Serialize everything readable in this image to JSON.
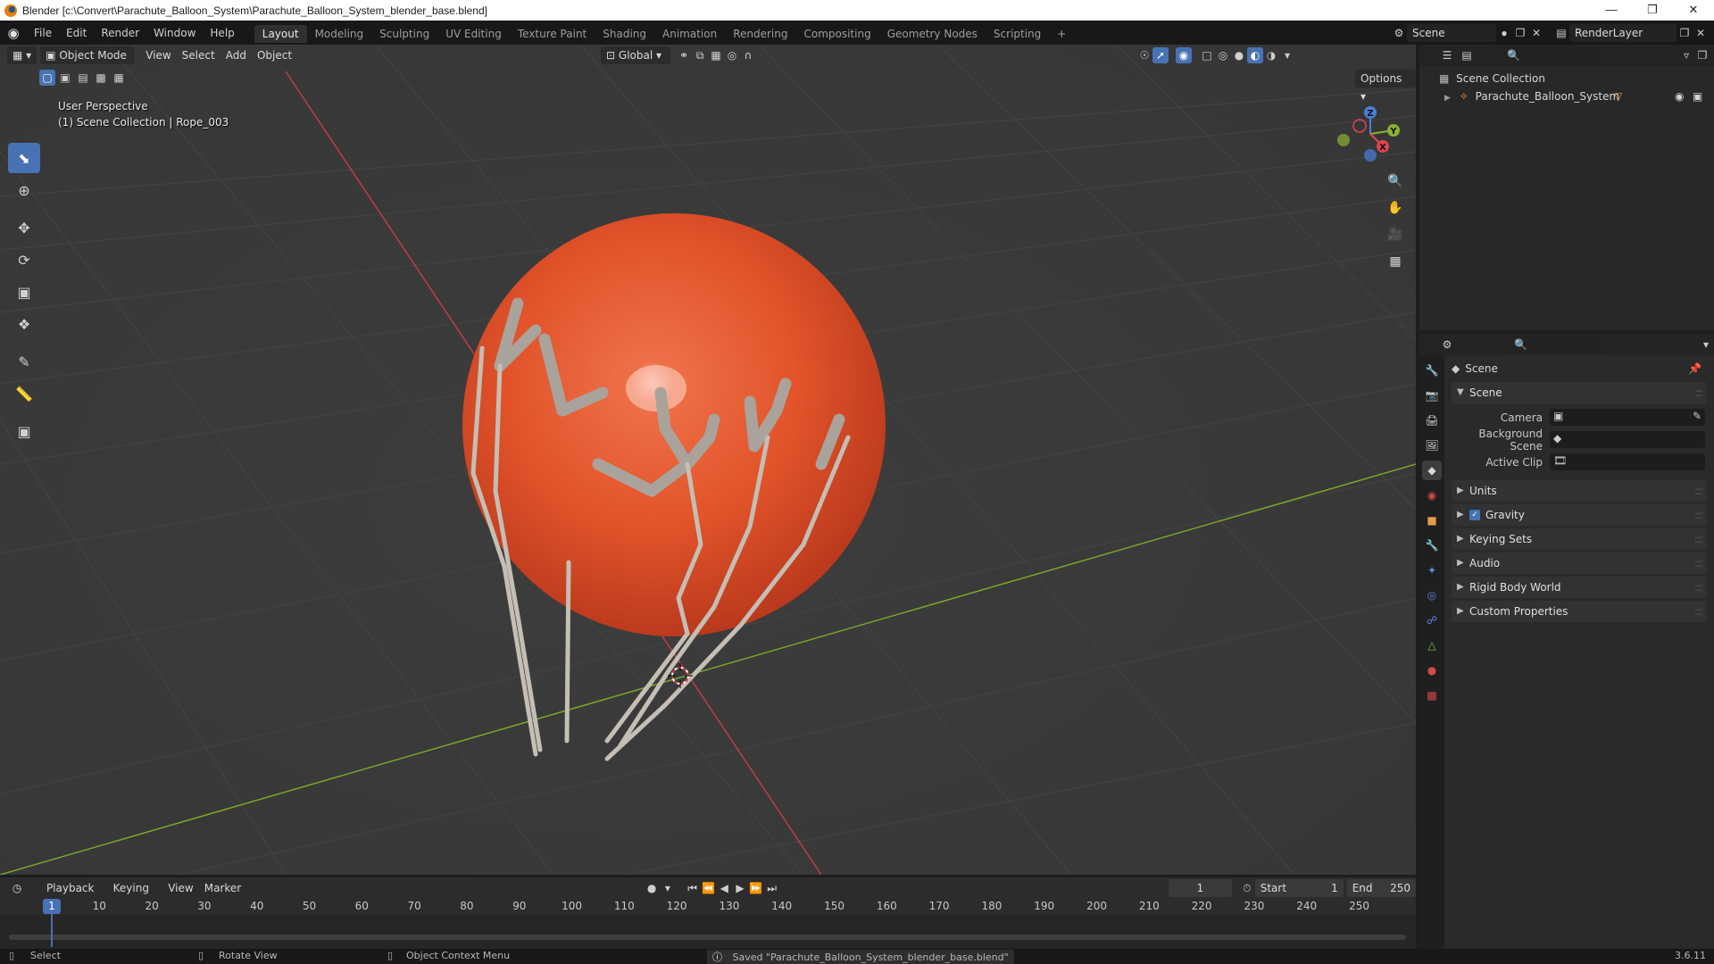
{
  "window": {
    "title": "Blender [c:\\Convert\\Parachute_Balloon_System\\Parachute_Balloon_System_blender_base.blend]"
  },
  "menubar": {
    "items": [
      "File",
      "Edit",
      "Render",
      "Window",
      "Help"
    ],
    "workspaces": [
      "Layout",
      "Modeling",
      "Sculpting",
      "UV Editing",
      "Texture Paint",
      "Shading",
      "Animation",
      "Rendering",
      "Compositing",
      "Geometry Nodes",
      "Scripting"
    ],
    "active_workspace": "Layout",
    "add_workspace": "+",
    "scene": "Scene",
    "view_layer": "RenderLayer"
  },
  "viewport": {
    "mode": "Object Mode",
    "menus": [
      "View",
      "Select",
      "Add",
      "Object"
    ],
    "orientation": "Global",
    "options_label": "Options",
    "perspective_label": "User Perspective",
    "context_label": "(1) Scene Collection | Rope_003",
    "gizmo_axes": {
      "x": "X",
      "y": "Y",
      "z": "Z"
    }
  },
  "outliner": {
    "collection": "Scene Collection",
    "items": [
      "Parachute_Balloon_System"
    ]
  },
  "properties": {
    "title": "Scene",
    "section": "Scene",
    "fields": [
      {
        "label": "Camera"
      },
      {
        "label": "Background Scene"
      },
      {
        "label": "Active Clip"
      }
    ],
    "panels": [
      "Units",
      "Gravity",
      "Keying Sets",
      "Audio",
      "Rigid Body World",
      "Custom Properties"
    ],
    "gravity_checked": true
  },
  "timeline": {
    "menus": [
      "Playback",
      "Keying",
      "View",
      "Marker"
    ],
    "current_frame": "1",
    "start_label": "Start",
    "start": "1",
    "end_label": "End",
    "end": "250",
    "ruler": [
      "1",
      "10",
      "20",
      "30",
      "40",
      "50",
      "60",
      "70",
      "80",
      "90",
      "100",
      "110",
      "120",
      "130",
      "140",
      "150",
      "160",
      "170",
      "180",
      "190",
      "200",
      "210",
      "220",
      "230",
      "240",
      "250"
    ]
  },
  "statusbar": {
    "select": "Select",
    "rotate": "Rotate View",
    "context_menu": "Object Context Menu",
    "message": "Saved \"Parachute_Balloon_System_blender_base.blend\"",
    "version": "3.6.11"
  },
  "colors": {
    "accent": "#4772b3",
    "balloon": "#e2532a",
    "axis_x": "#c43b48",
    "axis_y": "#7aa62a"
  }
}
